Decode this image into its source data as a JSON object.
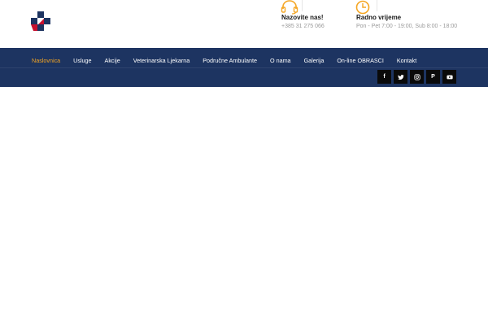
{
  "header": {
    "logo_icon": "veterinary-cross-logo-icon",
    "call": {
      "icon": "headset-icon",
      "title": "Nazovite nas!",
      "phone": "+385 31 275 066"
    },
    "hours": {
      "icon": "clock-icon",
      "title": "Radno vrijeme",
      "text": "Pon - Pet 7:00 - 19:00, Sub 8:00 - 18:00"
    },
    "accent_color": "#f5a623"
  },
  "nav": {
    "background": "#1d3461",
    "items": [
      {
        "label": "Naslovnica",
        "active": true
      },
      {
        "label": "Usluge"
      },
      {
        "label": "Akcije"
      },
      {
        "label": "Veterinarska Ljekarna"
      },
      {
        "label": "Područne Ambulante"
      },
      {
        "label": "O nama"
      },
      {
        "label": "Galerija"
      },
      {
        "label": "On-line OBRASCI"
      },
      {
        "label": "Kontakt"
      }
    ]
  },
  "social": [
    {
      "icon": "facebook-icon",
      "glyph": "f"
    },
    {
      "icon": "twitter-icon"
    },
    {
      "icon": "instagram-icon"
    },
    {
      "icon": "pinterest-icon",
      "glyph": "P"
    },
    {
      "icon": "youtube-icon"
    }
  ]
}
